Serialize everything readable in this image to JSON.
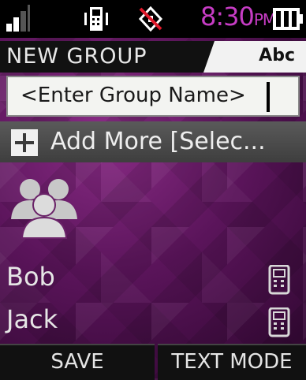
{
  "status_bar": {
    "time": "8:30",
    "ampm": "PM",
    "icons": [
      "signal-icon",
      "phone-vibrate-icon",
      "location-off-icon",
      "battery-icon"
    ]
  },
  "header": {
    "title": "NEW GROUP",
    "input_mode": "Abc"
  },
  "group_name_field": {
    "placeholder": "<Enter Group Name>"
  },
  "add_more": {
    "label": "Add More [Selec..."
  },
  "members": [
    {
      "name": "Bob",
      "icon": "mobile-phone-icon"
    },
    {
      "name": "Jack",
      "icon": "mobile-phone-icon"
    }
  ],
  "softkeys": {
    "left": "SAVE",
    "right": "TEXT MODE"
  },
  "colors": {
    "clock": "#c63cc4",
    "background": "#5a145a"
  }
}
